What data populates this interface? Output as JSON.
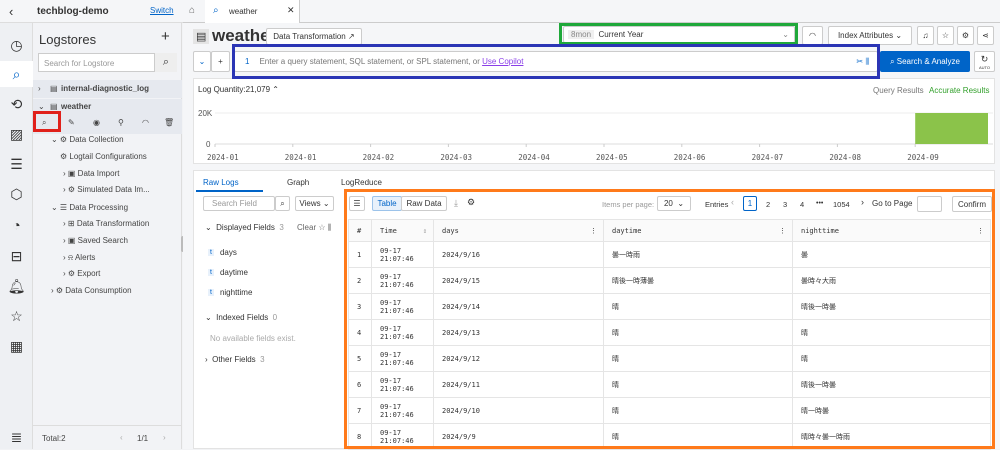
{
  "project": {
    "name": "techblog-demo",
    "switch": "Switch"
  },
  "tabs": [
    {
      "label": "weather"
    }
  ],
  "sidebar": {
    "title": "Logstores",
    "search_placeholder": "Search for Logstore",
    "logstores": [
      {
        "name": "internal-diagnostic_log"
      },
      {
        "name": "weather"
      }
    ],
    "tree": [
      "Data Collection",
      "Logtail Configurations",
      "Data Import",
      "Simulated Data Im...",
      "Data Processing",
      "Data Transformation",
      "Saved Search",
      "Alerts",
      "Export",
      "Data Consumption"
    ],
    "footer": {
      "total": "Total:2",
      "page": "1/1"
    }
  },
  "header": {
    "title": "weather",
    "data_transformation": "Data Transformation",
    "time_badge": "8mon",
    "time_range": "Current Year",
    "index_attributes": "Index Attributes",
    "auto": "AUTO"
  },
  "query": {
    "line": "1",
    "placeholder": "Enter a query statement, SQL statement, or SPL statement, or",
    "copilot": "Use Copilot",
    "search_button": "Search & Analyze"
  },
  "histogram": {
    "log_quantity": "Log Quantity:21,079",
    "query_results": "Query Results",
    "accurate_results": "Accurate Results",
    "accent": "#8bc34a"
  },
  "chart_data": {
    "type": "bar",
    "categories": [
      "2024-01",
      "2024-01",
      "2024-02",
      "2024-03",
      "2024-04",
      "2024-05",
      "2024-06",
      "2024-07",
      "2024-08",
      "2024-09"
    ],
    "values": [
      0,
      0,
      0,
      0,
      0,
      0,
      0,
      0,
      0,
      21079
    ],
    "yticks": [
      "20K",
      "0"
    ],
    "ylim": [
      0,
      21079
    ]
  },
  "lower_tabs": [
    "Raw Logs",
    "Graph",
    "LogReduce"
  ],
  "fields": {
    "search_placeholder": "Search Field",
    "views": "Views",
    "displayed": "Displayed Fields",
    "displayed_count": "3",
    "clear": "Clear",
    "displayed_items": [
      "days",
      "daytime",
      "nighttime"
    ],
    "type_label": "t",
    "indexed": "Indexed Fields",
    "indexed_count": "0",
    "no_fields": "No available fields exist.",
    "other": "Other Fields",
    "other_count": "3"
  },
  "table_toolbar": {
    "table": "Table",
    "raw": "Raw Data",
    "items_per_page": "Items per page:",
    "per_page": "20",
    "entries": "Entries",
    "pages": [
      "1",
      "2",
      "3",
      "4",
      "•••",
      "1054"
    ],
    "goto": "Go to Page",
    "confirm": "Confirm"
  },
  "table": {
    "columns": [
      "#",
      "Time",
      "days",
      "daytime",
      "nighttime"
    ],
    "rows": [
      [
        "1",
        "09-17 21:07:46",
        "2024/9/16",
        "曇一時雨",
        "曇"
      ],
      [
        "2",
        "09-17 21:07:46",
        "2024/9/15",
        "晴後一時薄曇",
        "曇時々大雨"
      ],
      [
        "3",
        "09-17 21:07:46",
        "2024/9/14",
        "晴",
        "晴後一時曇"
      ],
      [
        "4",
        "09-17 21:07:46",
        "2024/9/13",
        "晴",
        "晴"
      ],
      [
        "5",
        "09-17 21:07:46",
        "2024/9/12",
        "晴",
        "晴"
      ],
      [
        "6",
        "09-17 21:07:46",
        "2024/9/11",
        "晴",
        "晴後一時曇"
      ],
      [
        "7",
        "09-17 21:07:46",
        "2024/9/10",
        "晴",
        "晴一時曇"
      ],
      [
        "8",
        "09-17 21:07:46",
        "2024/9/9",
        "晴",
        "晴時々曇一時雨"
      ]
    ]
  },
  "highlights": {
    "red": "#e0201a",
    "green": "#1fa83a",
    "blue": "#2b35b5",
    "orange": "#ff7a1a"
  }
}
